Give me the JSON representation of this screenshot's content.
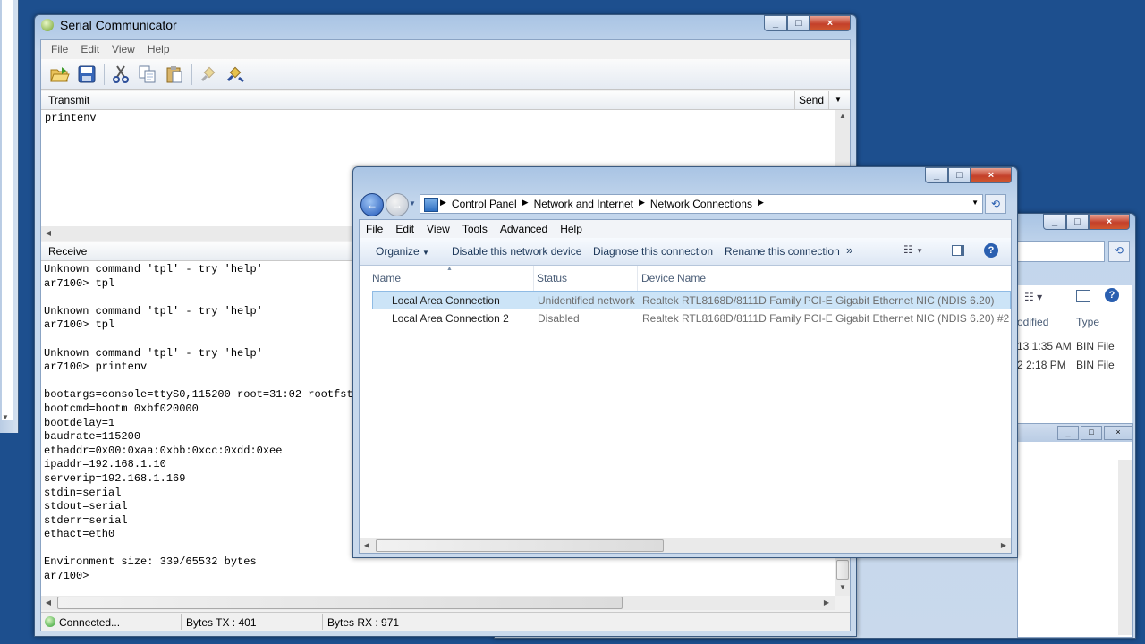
{
  "serial": {
    "title": "Serial Communicator",
    "menu": [
      "File",
      "Edit",
      "View",
      "Help"
    ],
    "transmit_label": "Transmit",
    "send_label": "Send",
    "transmit_text": "printenv",
    "receive_label": "Receive",
    "receive_text": "Unknown command 'tpl' - try 'help'\nar7100> tpl\n\nUnknown command 'tpl' - try 'help'\nar7100> tpl\n\nUnknown command 'tpl' - try 'help'\nar7100> printenv\n\nbootargs=console=ttyS0,115200 root=31:02 rootfstype=jffs2 init=/sbin/init\nbootcmd=bootm 0xbf020000\nbootdelay=1\nbaudrate=115200\nethaddr=0x00:0xaa:0xbb:0xcc:0xdd:0xee\nipaddr=192.168.1.10\nserverip=192.168.1.169\nstdin=serial\nstdout=serial\nstderr=serial\nethact=eth0\n\nEnvironment size: 339/65532 bytes\nar7100> ",
    "status": {
      "connected": "Connected...",
      "tx": "Bytes TX : 401",
      "rx": "Bytes RX : 971"
    }
  },
  "netconn": {
    "breadcrumb": [
      "Control Panel",
      "Network and Internet",
      "Network Connections"
    ],
    "menu": [
      "File",
      "Edit",
      "View",
      "Tools",
      "Advanced",
      "Help"
    ],
    "toolbar": {
      "organize": "Organize",
      "disable": "Disable this network device",
      "diagnose": "Diagnose this connection",
      "rename": "Rename this connection",
      "more": "»"
    },
    "columns": [
      "Name",
      "Status",
      "Device Name"
    ],
    "rows": [
      {
        "name": "Local Area Connection",
        "status": "Unidentified network",
        "device": "Realtek RTL8168D/8111D Family PCI-E Gigabit Ethernet NIC (NDIS 6.20)"
      },
      {
        "name": "Local Area Connection 2",
        "status": "Disabled",
        "device": "Realtek RTL8168D/8111D Family PCI-E Gigabit Ethernet NIC (NDIS 6.20) #2"
      }
    ]
  },
  "behind": {
    "col_modified": "odified",
    "col_type": "Type",
    "rows": [
      {
        "modified": "13 1:35 AM",
        "type": "BIN File"
      },
      {
        "modified": "2 2:18 PM",
        "type": "BIN File"
      }
    ]
  },
  "colors": {
    "desktop": "#1d4f8e",
    "selection": "#cce4f7",
    "accent": "#2a5fb0"
  }
}
